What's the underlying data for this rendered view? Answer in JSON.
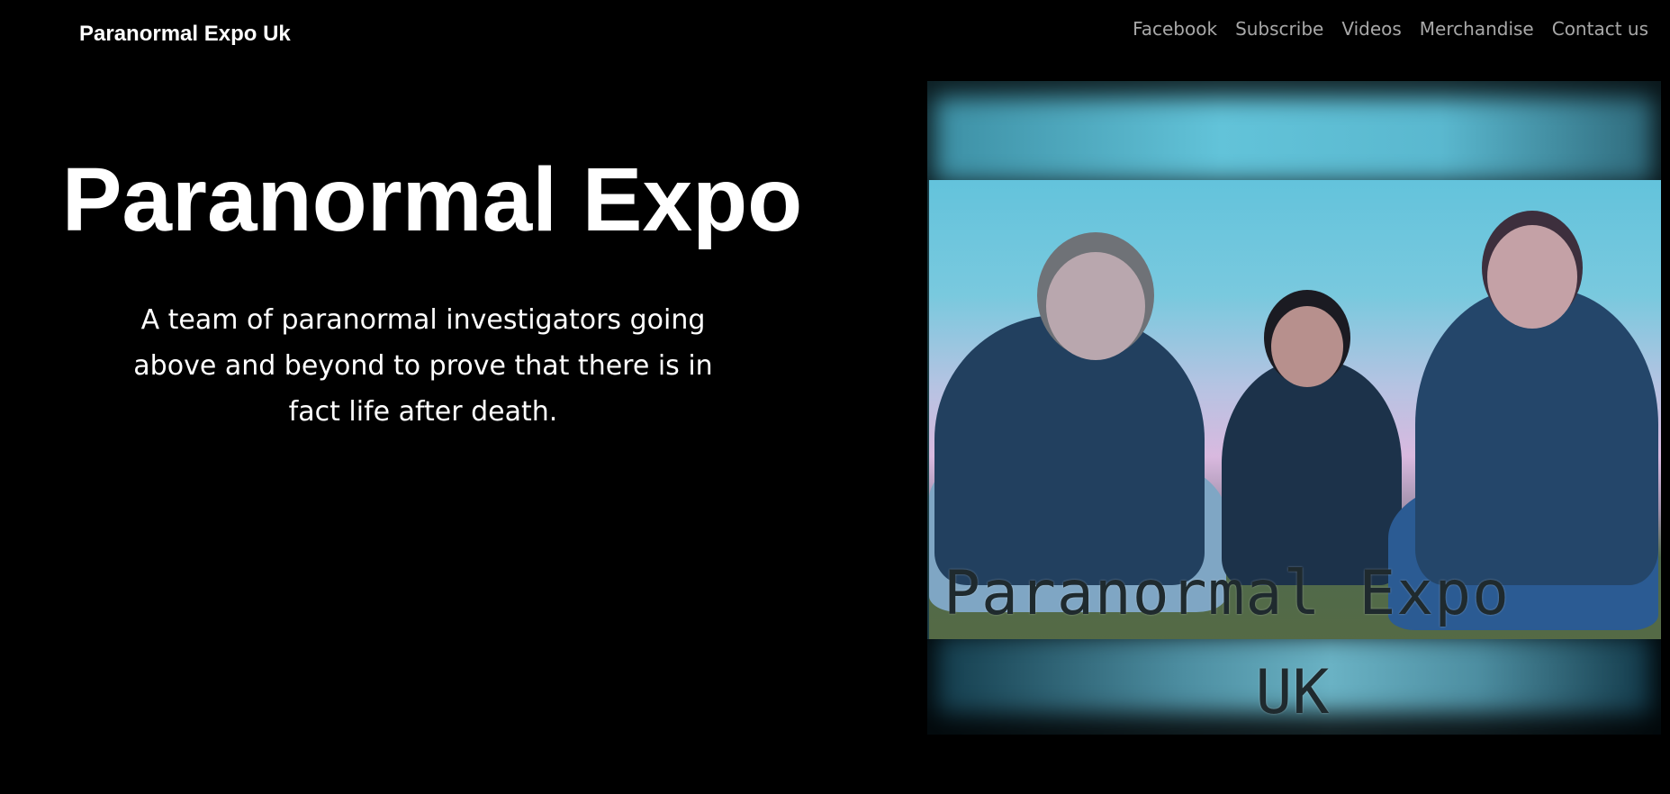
{
  "header": {
    "brand": "Paranormal Expo Uk",
    "nav": [
      {
        "label": "Facebook"
      },
      {
        "label": "Subscribe"
      },
      {
        "label": "Videos"
      },
      {
        "label": "Merchandise"
      },
      {
        "label": "Contact us"
      }
    ]
  },
  "hero": {
    "title": "Paranormal Expo",
    "subtitle": "A team of paranormal investigators going above and beyond to prove that there is in fact life after death.",
    "image": {
      "overlay_title": "Paranormal Expo",
      "overlay_subtitle": "UK"
    }
  },
  "colors": {
    "background": "#000000",
    "text": "#ffffff",
    "nav_text": "#a8a8a8"
  }
}
